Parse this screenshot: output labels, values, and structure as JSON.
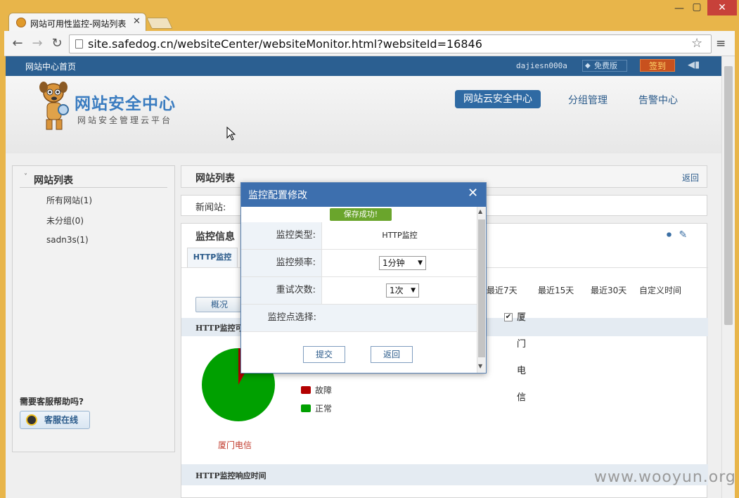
{
  "browser": {
    "tab_title": "网站可用性监控-网站列表",
    "url": "site.safedog.cn/websiteCenter/websiteMonitor.html?websiteId=16846"
  },
  "topnav": {
    "home": "网站中心首页",
    "user": "dajiesn000a",
    "free_badge": "免费版",
    "signin": "签到"
  },
  "header": {
    "logo_title": "网站安全中心",
    "logo_subtitle": "网站安全管理云平台",
    "nav": [
      "网站云安全中心",
      "分组管理",
      "告警中心"
    ]
  },
  "sidebar": {
    "title": "网站列表",
    "items": [
      "所有网站(1)",
      "未分组(0)",
      "sadn3s(1)"
    ],
    "help_text": "需要客服帮助吗?",
    "help_button": "客服在线"
  },
  "main": {
    "crumb": "网站列表",
    "back": "返回",
    "site_label": "新闻站:",
    "monitor_title": "监控信息",
    "tab": "HTTP监控",
    "ranges": [
      "最近7天",
      "最近15天",
      "最近30天",
      "自定义时间"
    ],
    "overview": "概况",
    "section1": "HTTP监控可",
    "pie_label": "厦门电信",
    "legend": [
      {
        "label": "故障",
        "color": "#b30000"
      },
      {
        "label": "正常",
        "color": "#00a000"
      }
    ],
    "pie": {
      "fault_fraction": 0.08
    },
    "section2": "HTTP监控响应时间"
  },
  "modal": {
    "title": "监控配置修改",
    "success": "保存成功!",
    "rows": {
      "type_label": "监控类型:",
      "type_value": "HTTP监控",
      "freq_label": "监控频率:",
      "freq_value": "1分钟",
      "retry_label": "重试次数:",
      "retry_value": "1次",
      "points_label": "监控点选择:",
      "points_value": "厦门电信"
    },
    "submit": "提交",
    "back": "返回"
  },
  "watermark": "www.wooyun.org"
}
